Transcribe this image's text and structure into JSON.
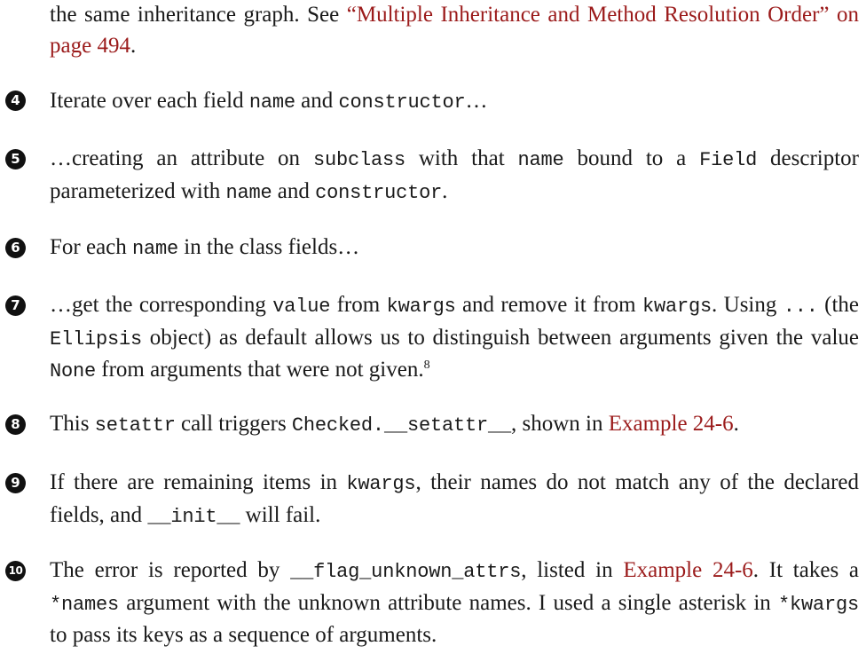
{
  "intro": {
    "text_before": "the same inheritance graph. See ",
    "link": "“Multiple Inheritance and Method Resolution Order” on page 494",
    "text_after": "."
  },
  "items": [
    {
      "marker": "4",
      "parts": [
        {
          "t": "Iterate over each field "
        },
        {
          "c": "name"
        },
        {
          "t": " and "
        },
        {
          "c": "constructor"
        },
        {
          "t": "…"
        }
      ]
    },
    {
      "marker": "5",
      "parts": [
        {
          "t": "…creating an attribute on "
        },
        {
          "c": "subclass"
        },
        {
          "t": " with that "
        },
        {
          "c": "name"
        },
        {
          "t": " bound to a "
        },
        {
          "c": "Field"
        },
        {
          "t": " descriptor parameterized with "
        },
        {
          "c": "name"
        },
        {
          "t": " and "
        },
        {
          "c": "constructor"
        },
        {
          "t": "."
        }
      ]
    },
    {
      "marker": "6",
      "parts": [
        {
          "t": "For each "
        },
        {
          "c": "name"
        },
        {
          "t": " in the class fields…"
        }
      ]
    },
    {
      "marker": "7",
      "parts": [
        {
          "t": "…get the corresponding "
        },
        {
          "c": "value"
        },
        {
          "t": " from "
        },
        {
          "c": "kwargs"
        },
        {
          "t": " and remove it from "
        },
        {
          "c": "kwargs"
        },
        {
          "t": ". Using "
        },
        {
          "c": "..."
        },
        {
          "t": " (the "
        },
        {
          "c": "Ellipsis"
        },
        {
          "t": " object) as default allows us to distinguish between argu­ments given the value "
        },
        {
          "c": "None"
        },
        {
          "t": " from arguments that were not given."
        },
        {
          "sup": "8"
        }
      ]
    },
    {
      "marker": "8",
      "parts": [
        {
          "t": "This "
        },
        {
          "c": "setattr"
        },
        {
          "t": " call triggers "
        },
        {
          "c": "Checked.__setattr__"
        },
        {
          "t": ", shown in "
        },
        {
          "l": "Example 24-6"
        },
        {
          "t": "."
        }
      ]
    },
    {
      "marker": "9",
      "parts": [
        {
          "t": "If there are remaining items in "
        },
        {
          "c": "kwargs"
        },
        {
          "t": ", their names do not match any of the declared fields, and "
        },
        {
          "c": "__init__"
        },
        {
          "t": " will fail."
        }
      ]
    },
    {
      "marker": "10",
      "parts": [
        {
          "t": "The error is reported by "
        },
        {
          "c": "__flag_unknown_attrs"
        },
        {
          "t": ", listed in "
        },
        {
          "l": "Example 24-6"
        },
        {
          "t": ". It takes a "
        },
        {
          "c": "*names"
        },
        {
          "t": " argument with the unknown attribute names. I used a single asterisk in "
        },
        {
          "c": "*kwargs"
        },
        {
          "t": " to pass its keys as a sequence of arguments."
        }
      ]
    }
  ]
}
